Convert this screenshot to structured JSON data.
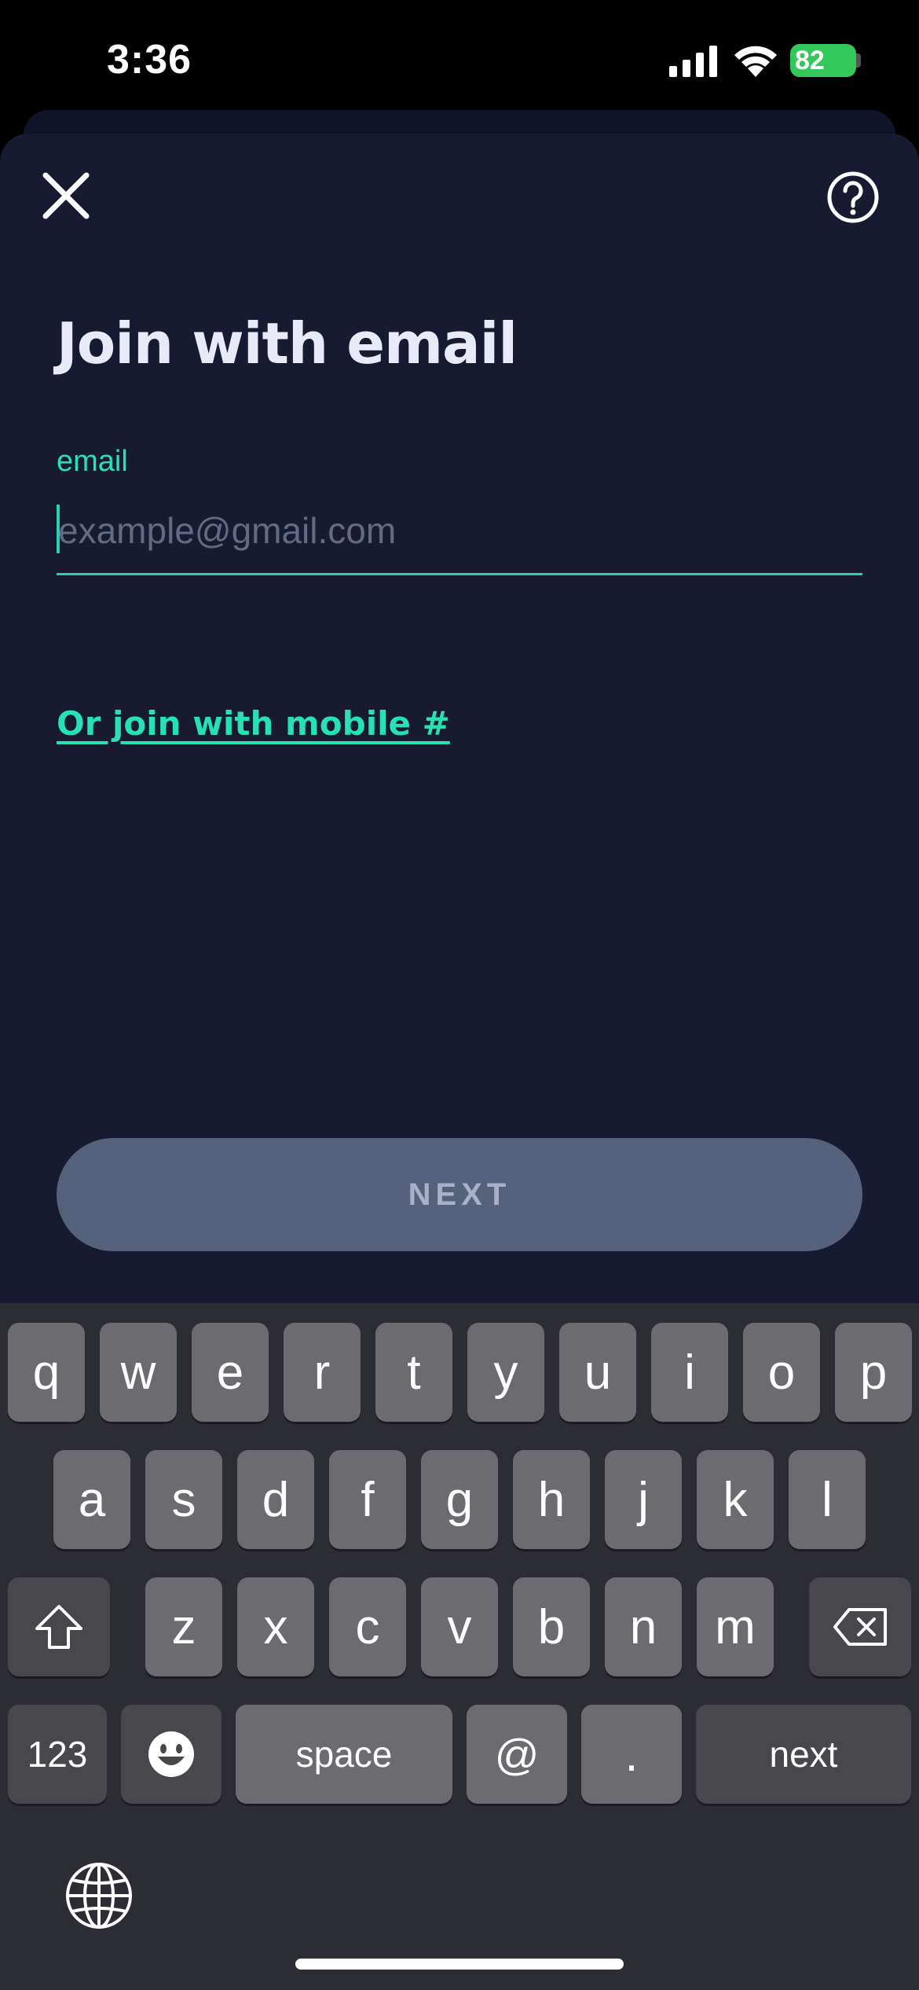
{
  "status_bar": {
    "time": "3:36",
    "battery": "82"
  },
  "screen": {
    "title": "Join with email",
    "email_label": "email",
    "email_placeholder": "example@gmail.com",
    "alt_link": "Or join with mobile #",
    "next_button": "NEXT",
    "icons": [
      "close-icon",
      "help-icon"
    ],
    "colors": {
      "background": "#171a30",
      "accent": "#27e0b3",
      "disabled_button": "#56627b"
    }
  },
  "keyboard": {
    "row1": [
      "q",
      "w",
      "e",
      "r",
      "t",
      "y",
      "u",
      "i",
      "o",
      "p"
    ],
    "row2": [
      "a",
      "s",
      "d",
      "f",
      "g",
      "h",
      "j",
      "k",
      "l"
    ],
    "row3": [
      "z",
      "x",
      "c",
      "v",
      "b",
      "n",
      "m"
    ],
    "bottom": {
      "numbers": "123",
      "space": "space",
      "at": "@",
      "dot": ".",
      "return": "next"
    },
    "icons": [
      "shift-icon",
      "backspace-icon",
      "emoji-icon",
      "globe-icon"
    ]
  }
}
